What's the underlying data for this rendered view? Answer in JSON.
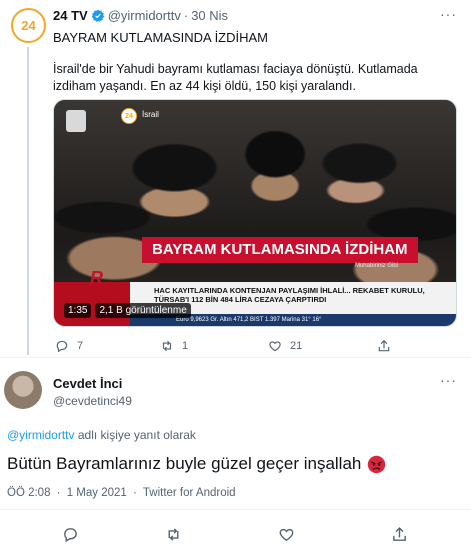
{
  "parent": {
    "avatar_text": "24",
    "name": "24 TV",
    "handle": "@yirmidorttv",
    "dot": "·",
    "date": "30 Nis",
    "more": "···",
    "title": "BAYRAM KUTLAMASINDA İZDİHAM",
    "text": "İsrail'de bir Yahudi bayramı kutlaması faciaya dönüştü. Kutlamada izdiham yaşandı. En az 44 kişi öldü, 150 kişi yaralandı.",
    "media": {
      "logo_text": "24",
      "location": "İsrail",
      "banner": "BAYRAM KUTLAMASINDA İZDİHAM",
      "reporter": "Muhabiriniz Gibi",
      "ticker_text": "HAC KAYITLARINDA KONTENJAN PAYLAŞIMI İHLALİ... REKABET KURULU, TÜRSAB'I 112 BİN 484 LİRA CEZAYA ÇARPTIRDI",
      "ticker_bar": "Euro 9,9623   Gr. Altın 471,2   BIST 1.397   Marina   31°  16°",
      "duration": "1:35",
      "views": "2,1 B görüntülenme",
      "brand_color": "#c8102e"
    },
    "actions": {
      "replies": "7",
      "retweets": "1",
      "likes": "21"
    }
  },
  "reply": {
    "name": "Cevdet İnci",
    "handle": "@cevdetinci49",
    "more": "···",
    "reply_link": "@yirmidorttv",
    "reply_suffix": " adlı kişiye yanıt olarak",
    "text": "Bütün Bayramlarınız buyle güzel geçer inşallah",
    "emoji": "angry-face",
    "time": "ÖÖ 2:08",
    "sep": "·",
    "date": "1 May 2021",
    "source": "Twitter for Android"
  },
  "colors": {
    "accent": "#1d9bf0",
    "secondary_text": "#536471",
    "brand_orange": "#f5a623"
  }
}
